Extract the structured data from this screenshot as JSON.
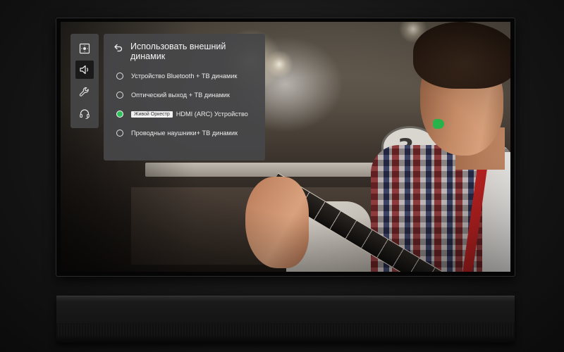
{
  "menu": {
    "title": "Использовать внешний динамик",
    "options": [
      {
        "label": "Устройство Bluetooth + ТВ динамик",
        "selected": false
      },
      {
        "label": "Оптический выход + ТВ динамик",
        "selected": false
      },
      {
        "badge": "Живой Оркестр",
        "label": "HDMI (ARC) Устройство",
        "selected": true
      },
      {
        "label": "Проводные наушники+ ТВ динамик",
        "selected": false
      }
    ]
  },
  "sidebar": {
    "items": [
      {
        "icon": "picture-settings-icon",
        "active": false
      },
      {
        "icon": "speaker-icon",
        "active": true
      },
      {
        "icon": "wrench-icon",
        "active": false
      },
      {
        "icon": "headset-icon",
        "active": false
      }
    ]
  },
  "scene": {
    "sign_text": "3"
  },
  "colors": {
    "accent": "#2fbf5b",
    "panel": "#464648",
    "active_icon_bg": "#1a1a1b"
  }
}
